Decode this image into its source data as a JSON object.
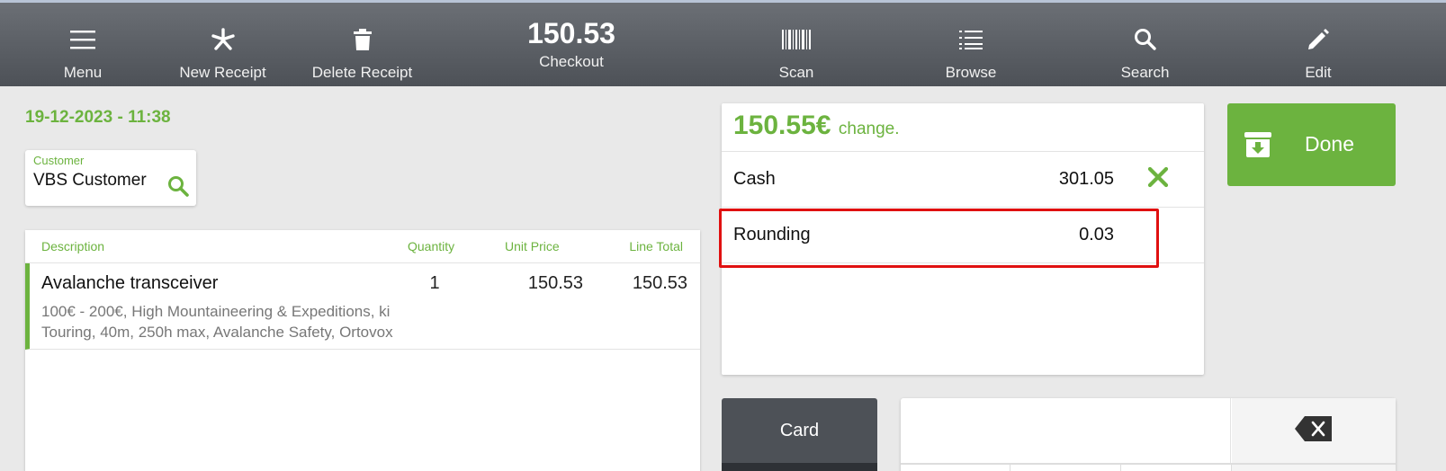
{
  "toolbar": {
    "menu_label": "Menu",
    "new_receipt_label": "New Receipt",
    "delete_receipt_label": "Delete Receipt",
    "checkout_amount": "150.53",
    "checkout_label": "Checkout",
    "scan_label": "Scan",
    "browse_label": "Browse",
    "search_label": "Search",
    "edit_label": "Edit"
  },
  "receipt": {
    "datetime": "19-12-2023 - 11:38",
    "customer_label": "Customer",
    "customer_name": "VBS Customer"
  },
  "items_table": {
    "headers": {
      "description": "Description",
      "quantity": "Quantity",
      "unit_price": "Unit Price",
      "line_total": "Line Total"
    },
    "rows": [
      {
        "name": "Avalanche transceiver",
        "details": "100€ - 200€, High Mountaineering & Expeditions, ki Touring, 40m, 250h max, Avalanche Safety, Ortovox",
        "quantity": "1",
        "unit_price": "150.53",
        "line_total": "150.53"
      }
    ]
  },
  "payment": {
    "change_amount": "150.55€",
    "change_label": "change.",
    "lines": [
      {
        "label": "Cash",
        "value": "301.05"
      },
      {
        "label": "Rounding",
        "value": "0.03"
      }
    ]
  },
  "done_label": "Done",
  "methods": [
    {
      "label": "Card"
    }
  ],
  "colors": {
    "accent": "#6cb33f",
    "toolbar": "#4d5157",
    "highlight": "#e01010"
  }
}
